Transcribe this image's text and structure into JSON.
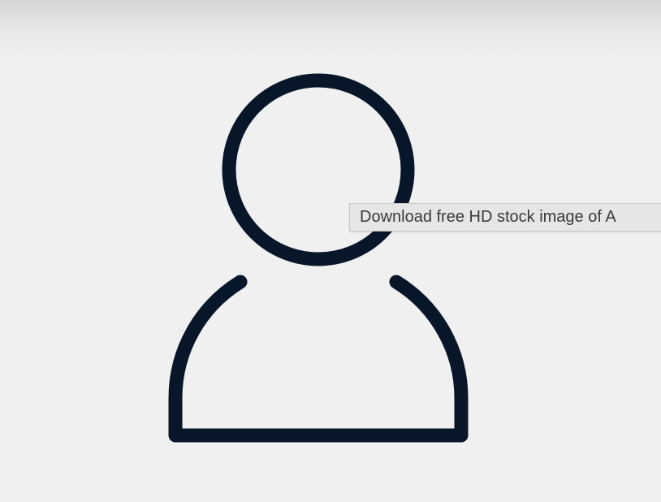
{
  "image": {
    "icon": "user-icon",
    "stroke_color": "#071629",
    "background_color": "#f0f0f0"
  },
  "tooltip": {
    "text": "Download free HD stock image of A"
  }
}
